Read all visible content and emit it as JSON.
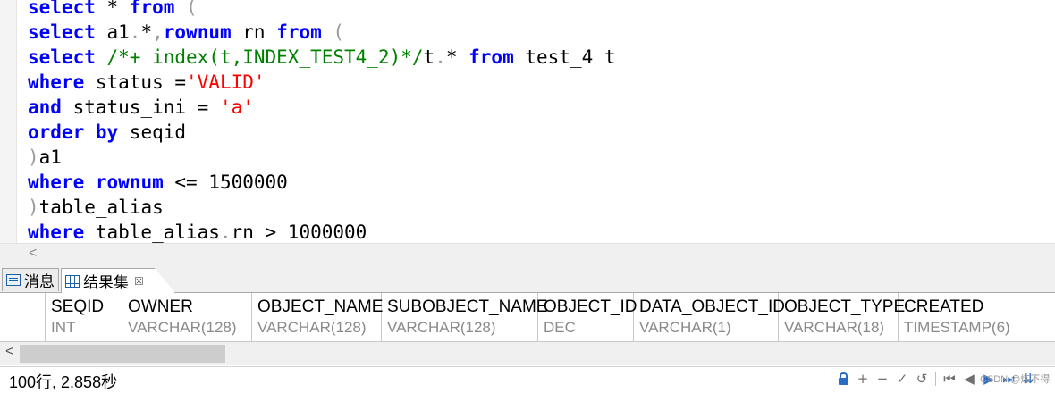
{
  "editor": {
    "lines": [
      [
        {
          "t": "select",
          "c": "kw"
        },
        {
          "t": " * ",
          "c": ""
        },
        {
          "t": "from",
          "c": "kw"
        },
        {
          "t": " (",
          "c": "pun"
        }
      ],
      [
        {
          "t": "select",
          "c": "kw"
        },
        {
          "t": " a1",
          "c": ""
        },
        {
          "t": ".",
          "c": "pun"
        },
        {
          "t": "*",
          "c": ""
        },
        {
          "t": ",",
          "c": "pun"
        },
        {
          "t": "rownum",
          "c": "kw"
        },
        {
          "t": " rn ",
          "c": ""
        },
        {
          "t": "from",
          "c": "kw"
        },
        {
          "t": " (",
          "c": "pun"
        }
      ],
      [
        {
          "t": "select",
          "c": "kw"
        },
        {
          "t": " ",
          "c": ""
        },
        {
          "t": "/*+ index(t,INDEX_TEST4_2)*/",
          "c": "cmt"
        },
        {
          "t": "t",
          "c": ""
        },
        {
          "t": ".",
          "c": "pun"
        },
        {
          "t": "* ",
          "c": ""
        },
        {
          "t": "from",
          "c": "kw"
        },
        {
          "t": " test_4 t",
          "c": ""
        }
      ],
      [
        {
          "t": "where",
          "c": "kw"
        },
        {
          "t": " status =",
          "c": ""
        },
        {
          "t": "'VALID'",
          "c": "str"
        }
      ],
      [
        {
          "t": "and",
          "c": "kw"
        },
        {
          "t": " status_ini = ",
          "c": ""
        },
        {
          "t": "'a'",
          "c": "str"
        }
      ],
      [
        {
          "t": "order by",
          "c": "kw"
        },
        {
          "t": " seqid",
          "c": ""
        }
      ],
      [
        {
          "t": ")",
          "c": "pun"
        },
        {
          "t": "a1",
          "c": ""
        }
      ],
      [
        {
          "t": "where",
          "c": "kw"
        },
        {
          "t": " ",
          "c": ""
        },
        {
          "t": "rownum",
          "c": "kw"
        },
        {
          "t": " <= 1500000",
          "c": ""
        }
      ],
      [
        {
          "t": ")",
          "c": "pun"
        },
        {
          "t": "table_alias",
          "c": ""
        }
      ],
      [
        {
          "t": "where",
          "c": "kw"
        },
        {
          "t": " table_alias",
          "c": ""
        },
        {
          "t": ".",
          "c": "pun"
        },
        {
          "t": "rn > 1000000",
          "c": ""
        }
      ]
    ]
  },
  "editor_scroll": {
    "left_arrow": "<"
  },
  "tabs": {
    "messages": "消息",
    "results": "结果集",
    "close": "☒"
  },
  "grid": {
    "columns": [
      {
        "name": "SEQID",
        "type": "INT"
      },
      {
        "name": "OWNER",
        "type": "VARCHAR(128)"
      },
      {
        "name": "OBJECT_NAME",
        "type": "VARCHAR(128)"
      },
      {
        "name": "SUBOBJECT_NAME",
        "type": "VARCHAR(128)"
      },
      {
        "name": "OBJECT_ID",
        "type": "DEC"
      },
      {
        "name": "DATA_OBJECT_ID",
        "type": "VARCHAR(1)"
      },
      {
        "name": "OBJECT_TYPE",
        "type": "VARCHAR(18)"
      },
      {
        "name": "CREATED",
        "type": "TIMESTAMP(6)"
      }
    ]
  },
  "grid_scroll": {
    "left_arrow": "<"
  },
  "status": {
    "text": "100行, 2.858秒",
    "watermark": "CSDN @炼不得"
  },
  "toolbar": {
    "add": "+",
    "remove": "−",
    "commit": "✓",
    "undo": "↺",
    "first": "⏮",
    "prev": "◀",
    "next": "▶",
    "last": "⏭",
    "expand": "⇊"
  },
  "colors": {
    "keyword": "#0000ff",
    "string": "#ff0000",
    "comment": "#008000",
    "accent": "#2b6cc4"
  }
}
